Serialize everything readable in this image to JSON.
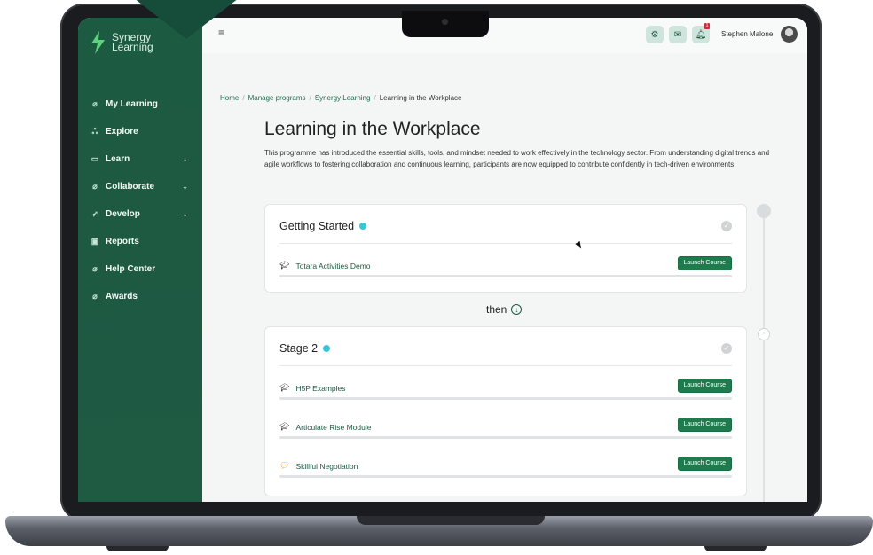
{
  "brand": {
    "name_line1": "Synergy",
    "name_line2": "Learning",
    "mark": "™"
  },
  "sidebar": {
    "items": [
      {
        "label": "My Learning",
        "icon": "leaf-icon",
        "chevron": false
      },
      {
        "label": "Explore",
        "icon": "people-icon",
        "chevron": false
      },
      {
        "label": "Learn",
        "icon": "book-icon",
        "chevron": true
      },
      {
        "label": "Collaborate",
        "icon": "leaf-icon",
        "chevron": true
      },
      {
        "label": "Develop",
        "icon": "rocket-icon",
        "chevron": true
      },
      {
        "label": "Reports",
        "icon": "chart-icon",
        "chevron": false
      },
      {
        "label": "Help Center",
        "icon": "leaf-icon",
        "chevron": false
      },
      {
        "label": "Awards",
        "icon": "leaf-icon",
        "chevron": false
      }
    ]
  },
  "topbar": {
    "menu_icon": "hamburger-icon",
    "notification_count": "1",
    "user_name": "Stephen Malone"
  },
  "breadcrumb": [
    "Home",
    "Manage programs",
    "Synergy Learning",
    "Learning in the Workplace"
  ],
  "page": {
    "title": "Learning in the Workplace",
    "description": "This programme has introduced the essential skills, tools, and mindset needed to work effectively in the technology sector. From understanding digital trends and agile workflows to fostering collaboration and continuous learning, participants are now equipped to contribute confidently in tech-driven environments."
  },
  "stages": [
    {
      "title": "Getting Started",
      "courses": [
        {
          "name": "Totara Activities Demo",
          "icon": "graduation-cap-icon",
          "button": "Launch Course"
        }
      ]
    },
    {
      "title": "Stage 2",
      "courses": [
        {
          "name": "H5P Examples",
          "icon": "graduation-cap-icon",
          "button": "Launch Course"
        },
        {
          "name": "Articulate Rise Module",
          "icon": "graduation-cap-icon",
          "button": "Launch Course"
        },
        {
          "name": "Skillful Negotiation",
          "icon": "chat-bubbles-icon",
          "button": "Launch Course"
        }
      ]
    }
  ],
  "connector": {
    "label": "then"
  },
  "colors": {
    "sidebar": "#1d5a42",
    "accent": "#1f7a4d",
    "info": "#3bc6d8"
  }
}
